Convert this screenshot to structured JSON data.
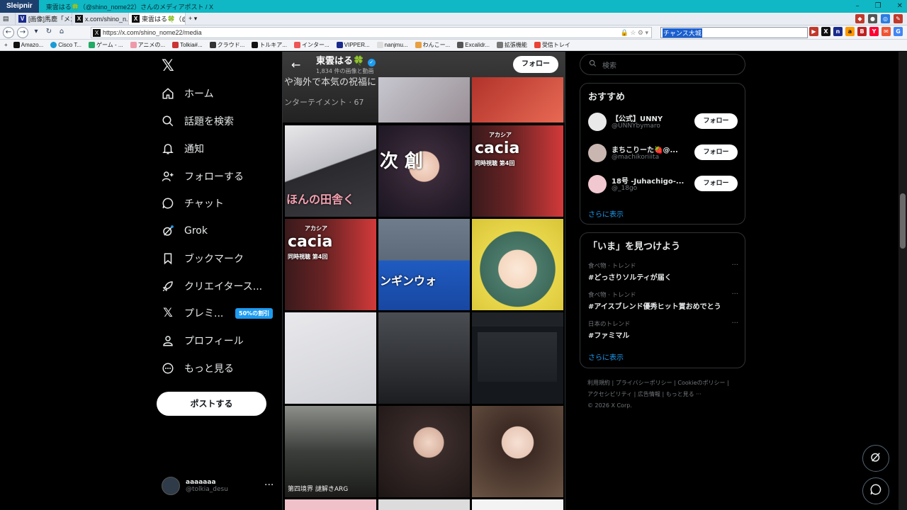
{
  "browser": {
    "app_name": "Sleipnir",
    "window_title": "東雲はる🍀（@shino_nome22）さんのメディアポスト / X",
    "tabs": [
      {
        "label": "[画像]馬鹿「メガ...",
        "icon": "V"
      },
      {
        "label": "x.com/shino_n...",
        "icon": "X"
      },
      {
        "label": "東雲はる🍀（@s...",
        "icon": "X",
        "active": true
      }
    ],
    "url": "https://x.com/shino_nome22/media",
    "search_value": "チャンス大城",
    "bookmarks": [
      "Amazo...",
      "Cisco T...",
      "ゲーム - ...",
      "アニメの...",
      "Tolkia#...",
      "クラウド...",
      "トルキア...",
      "インター...",
      "VIPPER...",
      "nanjmu...",
      "わんこー...",
      "Excalidr...",
      "拡張機能",
      "受信トレイ"
    ]
  },
  "nav": {
    "items": [
      {
        "label": "ホーム",
        "icon": "home-icon"
      },
      {
        "label": "話題を検索",
        "icon": "search-icon"
      },
      {
        "label": "通知",
        "icon": "bell-icon"
      },
      {
        "label": "フォローする",
        "icon": "add-person-icon"
      },
      {
        "label": "チャット",
        "icon": "chat-icon"
      },
      {
        "label": "Grok",
        "icon": "grok-icon"
      },
      {
        "label": "ブックマーク",
        "icon": "bookmark-icon"
      },
      {
        "label": "クリエイタース...",
        "icon": "rocket-icon"
      },
      {
        "label": "プレミ...",
        "icon": "x-icon"
      },
      {
        "label": "プロフィール",
        "icon": "person-icon"
      },
      {
        "label": "もっと見る",
        "icon": "more-circle-icon"
      }
    ],
    "premium_badge": "50%の割引",
    "post_button": "ポストする",
    "account": {
      "name": "aaaaaaa",
      "handle": "@tolkia_desu"
    }
  },
  "profile": {
    "name": "東雲はる🍀",
    "post_count": "1,834 件の画像と動画",
    "follow_label": "フォロー",
    "banner_line1": "や海外で本気の祝福に",
    "banner_line2": "ンターテイメント · 67",
    "tile_texts": {
      "t3": "ほんの田舎く",
      "t4": "次 創",
      "t5": "cacia",
      "t5sub": "アカシア",
      "t5cap": "同時視聴 第4回",
      "t6": "cacia",
      "t6sub": "アカシア",
      "t6cap": "同時視聴 第4回",
      "t7": "ンギンウォ",
      "t13": "第四境界 謎解きARG"
    }
  },
  "right": {
    "search_placeholder": "検索",
    "recommend_title": "おすすめ",
    "recommendations": [
      {
        "name": "【公式】UNNY",
        "handle": "@UNNYbymaro",
        "button": "フォロー"
      },
      {
        "name": "まちこりーた🍓@...",
        "handle": "@machikoriiita",
        "button": "フォロー"
      },
      {
        "name": "18号 -Juhachigo-...",
        "handle": "@_18go",
        "button": "フォロー"
      }
    ],
    "show_more": "さらに表示",
    "trends_title": "「いま」を見つけよう",
    "trends": [
      {
        "context": "食べ物 · トレンド",
        "topic": "#どっさりソルティが届く"
      },
      {
        "context": "食べ物 · トレンド",
        "topic": "#アイスブレンド優秀ヒット賞おめでとう"
      },
      {
        "context": "日本のトレンド",
        "topic": "#ファミマル"
      }
    ],
    "footer_links": [
      "利用規約",
      "プライバシーポリシー",
      "Cookieのポリシー",
      "アクセシビリティ",
      "広告情報",
      "もっと見る ···"
    ],
    "copyright": "© 2026 X Corp."
  }
}
